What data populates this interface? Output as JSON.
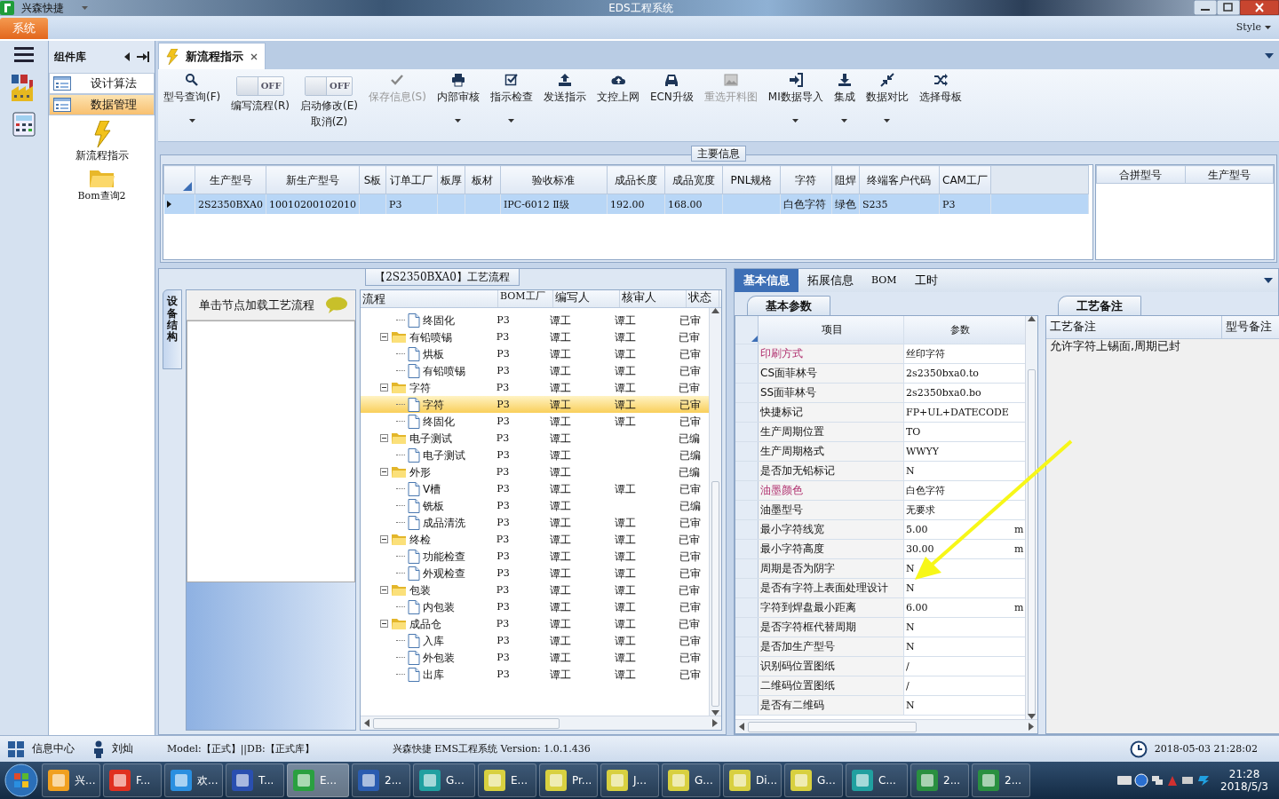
{
  "window": {
    "app_name": "兴森快捷",
    "title": "EDS工程系统"
  },
  "ribbon": {
    "tabs": [
      {
        "label": "系统",
        "selected": true
      }
    ],
    "style_menu": "Style"
  },
  "component_panel": {
    "title": "组件库",
    "items": [
      {
        "label": "设计算法",
        "selected": false
      },
      {
        "label": "数据管理",
        "selected": true
      }
    ],
    "shortcuts": [
      "新流程指示",
      "Bom查询2"
    ]
  },
  "doc_tabs": [
    {
      "label": "新流程指示",
      "selected": true
    }
  ],
  "toolbar": [
    {
      "kind": "button",
      "label": "型号查询(F)",
      "dropdown": true,
      "disabled": false
    },
    {
      "kind": "toggle",
      "label": "编写流程(R)",
      "on": false,
      "toggle_text": "OFF"
    },
    {
      "kind": "toggle",
      "label": "启动修改(E)",
      "label2": "取消(Z)",
      "on": false,
      "toggle_text": "OFF"
    },
    {
      "kind": "button",
      "label": "保存信息(S)",
      "dropdown": false,
      "disabled": true
    },
    {
      "kind": "button",
      "label": "内部审核",
      "dropdown": true,
      "disabled": false
    },
    {
      "kind": "button",
      "label": "指示检查",
      "dropdown": true,
      "disabled": false
    },
    {
      "kind": "button",
      "label": "发送指示",
      "dropdown": false,
      "disabled": false
    },
    {
      "kind": "button",
      "label": "文控上网",
      "dropdown": false,
      "disabled": false
    },
    {
      "kind": "button",
      "label": "ECN升级",
      "dropdown": false,
      "disabled": false
    },
    {
      "kind": "button",
      "label": "重选开料图",
      "dropdown": false,
      "disabled": true
    },
    {
      "kind": "button",
      "label": "MI数据导入",
      "dropdown": true,
      "disabled": false
    },
    {
      "kind": "button",
      "label": "集成",
      "dropdown": true,
      "disabled": false
    },
    {
      "kind": "button",
      "label": "数据对比",
      "dropdown": true,
      "disabled": false
    },
    {
      "kind": "button",
      "label": "选择母板",
      "dropdown": false,
      "disabled": false
    }
  ],
  "main_info": {
    "title": "主要信息",
    "columns": [
      "生产型号",
      "新生产型号",
      "S板",
      "订单工厂",
      "板厚",
      "板材",
      "验收标准",
      "成品长度",
      "成品宽度",
      "PNL规格",
      "字符",
      "阻焊",
      "终端客户代码",
      "CAM工厂"
    ],
    "rows": [
      {
        "selected": true,
        "cells": [
          "2S2350BXA0",
          "10010200102010",
          null,
          "P3",
          null,
          null,
          "IPC-6012 Ⅱ级",
          "192.00",
          "168.00",
          null,
          "白色字符",
          "绿色",
          "S235",
          "P3"
        ]
      }
    ],
    "side_columns": [
      "合拼型号",
      "生产型号"
    ]
  },
  "process": {
    "title": "【2S2350BXA0】工艺流程",
    "side_tab": "设备结构",
    "prompt": "单击节点加载工艺流程",
    "columns": [
      "流程",
      "BOM工厂",
      "编写人",
      "核审人",
      "状态"
    ],
    "tree": [
      {
        "children": [
          {
            "label": "终固化",
            "bom": "P3",
            "writer": "谭工",
            "reviewer": "谭工",
            "status": "已审",
            "selected": false
          }
        ]
      },
      {
        "label": "有铅喷锡",
        "bom": "P3",
        "writer": "谭工",
        "reviewer": "谭工",
        "status": "已审",
        "selected": false,
        "expanded": true,
        "children": [
          {
            "label": "烘板",
            "bom": "P3",
            "writer": "谭工",
            "reviewer": "谭工",
            "status": "已审",
            "selected": false
          },
          {
            "label": "有铅喷锡",
            "bom": "P3",
            "writer": "谭工",
            "reviewer": "谭工",
            "status": "已审",
            "selected": false
          }
        ]
      },
      {
        "label": "字符",
        "bom": "P3",
        "writer": "谭工",
        "reviewer": "谭工",
        "status": "已审",
        "selected": false,
        "expanded": true,
        "children": [
          {
            "label": "字符",
            "bom": "P3",
            "writer": "谭工",
            "reviewer": "谭工",
            "status": "已审",
            "selected": true
          },
          {
            "label": "终固化",
            "bom": "P3",
            "writer": "谭工",
            "reviewer": "谭工",
            "status": "已审",
            "selected": false
          }
        ]
      },
      {
        "label": "电子测试",
        "bom": "P3",
        "writer": "谭工",
        "status": "已编",
        "selected": false,
        "expanded": true,
        "children": [
          {
            "label": "电子测试",
            "bom": "P3",
            "writer": "谭工",
            "status": "已编",
            "selected": false
          }
        ]
      },
      {
        "label": "外形",
        "bom": "P3",
        "writer": "谭工",
        "status": "已编",
        "selected": false,
        "expanded": true,
        "children": [
          {
            "label": "V槽",
            "bom": "P3",
            "writer": "谭工",
            "reviewer": "谭工",
            "status": "已审",
            "selected": false
          },
          {
            "label": "铣板",
            "bom": "P3",
            "writer": "谭工",
            "status": "已编",
            "selected": false
          },
          {
            "label": "成品清洗",
            "bom": "P3",
            "writer": "谭工",
            "reviewer": "谭工",
            "status": "已审",
            "selected": false
          }
        ]
      },
      {
        "label": "终检",
        "bom": "P3",
        "writer": "谭工",
        "reviewer": "谭工",
        "status": "已审",
        "selected": false,
        "expanded": true,
        "children": [
          {
            "label": "功能检查",
            "bom": "P3",
            "writer": "谭工",
            "reviewer": "谭工",
            "status": "已审",
            "selected": false
          },
          {
            "label": "外观检查",
            "bom": "P3",
            "writer": "谭工",
            "reviewer": "谭工",
            "status": "已审",
            "selected": false
          }
        ]
      },
      {
        "label": "包装",
        "bom": "P3",
        "writer": "谭工",
        "reviewer": "谭工",
        "status": "已审",
        "selected": false,
        "expanded": true,
        "children": [
          {
            "label": "内包装",
            "bom": "P3",
            "writer": "谭工",
            "reviewer": "谭工",
            "status": "已审",
            "selected": false
          }
        ]
      },
      {
        "label": "成品仓",
        "bom": "P3",
        "writer": "谭工",
        "reviewer": "谭工",
        "status": "已审",
        "selected": false,
        "expanded": true,
        "children": [
          {
            "label": "入库",
            "bom": "P3",
            "writer": "谭工",
            "reviewer": "谭工",
            "status": "已审",
            "selected": false
          },
          {
            "label": "外包装",
            "bom": "P3",
            "writer": "谭工",
            "reviewer": "谭工",
            "status": "已审",
            "selected": false
          },
          {
            "label": "出库",
            "bom": "P3",
            "writer": "谭工",
            "reviewer": "谭工",
            "status": "已审",
            "selected": false
          }
        ]
      }
    ]
  },
  "info_tabs": [
    {
      "label": "基本信息",
      "selected": true
    },
    {
      "label": "拓展信息",
      "selected": false
    },
    {
      "label": "BOM",
      "selected": false
    },
    {
      "label": "工时",
      "selected": false
    }
  ],
  "params": {
    "tab": "基本参数",
    "columns": [
      "项目",
      "参数"
    ],
    "rows": [
      {
        "item": "印刷方式",
        "value": "丝印字符",
        "flagged": true
      },
      {
        "item": "CS面菲林号",
        "value": "2s2350bxa0.to",
        "flagged": false
      },
      {
        "item": "SS面菲林号",
        "value": "2s2350bxa0.bo",
        "flagged": false
      },
      {
        "item": "快捷标记",
        "value": "FP+UL+DATECODE",
        "flagged": false
      },
      {
        "item": "生产周期位置",
        "value": "TO",
        "flagged": false
      },
      {
        "item": "生产周期格式",
        "value": "WWYY",
        "flagged": false
      },
      {
        "item": "是否加无铅标记",
        "value": "N",
        "flagged": false
      },
      {
        "item": "油墨颜色",
        "value": "白色字符",
        "flagged": true
      },
      {
        "item": "油墨型号",
        "value": "无要求",
        "flagged": false
      },
      {
        "item": "最小字符线宽",
        "value": "5.00",
        "unit": "m",
        "flagged": false
      },
      {
        "item": "最小字符高度",
        "value": "30.00",
        "unit": "m",
        "flagged": false
      },
      {
        "item": "周期是否为阴字",
        "value": "N",
        "flagged": false
      },
      {
        "item": "是否有字符上表面处理设计",
        "value": "N",
        "flagged": false
      },
      {
        "item": "字符到焊盘最小距离",
        "value": "6.00",
        "unit": "m",
        "flagged": false
      },
      {
        "item": "是否字符框代替周期",
        "value": "N",
        "flagged": false
      },
      {
        "item": "是否加生产型号",
        "value": "N",
        "flagged": false
      },
      {
        "item": "识别码位置图纸",
        "value": "/",
        "flagged": false
      },
      {
        "item": "二维码位置图纸",
        "value": "/",
        "flagged": false
      },
      {
        "item": "是否有二维码",
        "value": "N",
        "flagged": false
      }
    ]
  },
  "remarks": {
    "tab": "工艺备注",
    "columns": [
      "工艺备注",
      "型号备注"
    ],
    "rows": [
      [
        "允许字符上锡面,周期已封"
      ]
    ]
  },
  "status_bar": {
    "info_center": "信息中心",
    "user": "刘灿",
    "model": "Model:【正式】||DB:【正式库】",
    "app_version": "兴森快捷 EMS工程系统 Version: 1.0.1.436",
    "datetime": "2018-05-03 21:28:02"
  },
  "taskbar": {
    "items": [
      {
        "label": "兴...",
        "selected": false
      },
      {
        "label": "F...",
        "selected": false
      },
      {
        "label": "欢...",
        "selected": false
      },
      {
        "label": "T...",
        "selected": false
      },
      {
        "label": "E...",
        "selected": true
      },
      {
        "label": "2...",
        "selected": false
      },
      {
        "label": "G...",
        "selected": false
      },
      {
        "label": "E...",
        "selected": false
      },
      {
        "label": "Pr...",
        "selected": false
      },
      {
        "label": "J...",
        "selected": false
      },
      {
        "label": "G...",
        "selected": false
      },
      {
        "label": "Di...",
        "selected": false
      },
      {
        "label": "G...",
        "selected": false
      },
      {
        "label": "C...",
        "selected": false
      },
      {
        "label": "2...",
        "selected": false
      },
      {
        "label": "2...",
        "selected": false
      }
    ],
    "time": "21:28",
    "date": "2018/5/3"
  }
}
